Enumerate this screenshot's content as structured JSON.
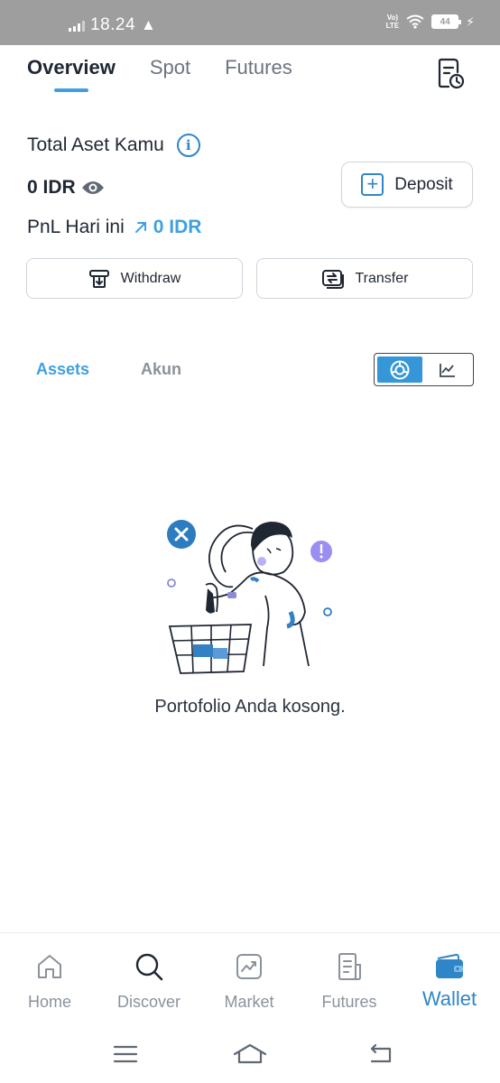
{
  "status_bar": {
    "time": "18.24",
    "volte_line1": "Vo)",
    "volte_line2": "LTE",
    "battery": "44"
  },
  "header": {
    "tabs": [
      {
        "label": "Overview",
        "active": true
      },
      {
        "label": "Spot",
        "active": false
      },
      {
        "label": "Futures",
        "active": false
      }
    ],
    "history_icon": "document-clock-icon"
  },
  "summary": {
    "total_label": "Total Aset Kamu",
    "balance": "0 IDR",
    "pnl_label": "PnL Hari ini",
    "pnl_value": "0 IDR",
    "deposit_label": "Deposit",
    "withdraw_label": "Withdraw",
    "transfer_label": "Transfer"
  },
  "assets_section": {
    "tabs": [
      {
        "label": "Assets",
        "active": true
      },
      {
        "label": "Akun",
        "active": false
      }
    ],
    "view_toggle": [
      "donut-chart-icon",
      "line-chart-icon"
    ],
    "selected_view": "donut-chart-icon"
  },
  "empty_state": {
    "message": "Portofolio Anda kosong."
  },
  "bottom_nav": {
    "items": [
      {
        "label": "Home",
        "icon": "home-icon",
        "active": false
      },
      {
        "label": "Discover",
        "icon": "search-icon",
        "active": false
      },
      {
        "label": "Market",
        "icon": "chart-icon",
        "active": false
      },
      {
        "label": "Futures",
        "icon": "document-icon",
        "active": false
      },
      {
        "label": "Wallet",
        "icon": "wallet-icon",
        "active": true
      }
    ]
  },
  "colors": {
    "accent": "#3fa0e0",
    "accent_dark": "#2f86c6",
    "status_bar": "#9e9e9e",
    "text": "#1f2733",
    "muted": "#8a929c"
  }
}
